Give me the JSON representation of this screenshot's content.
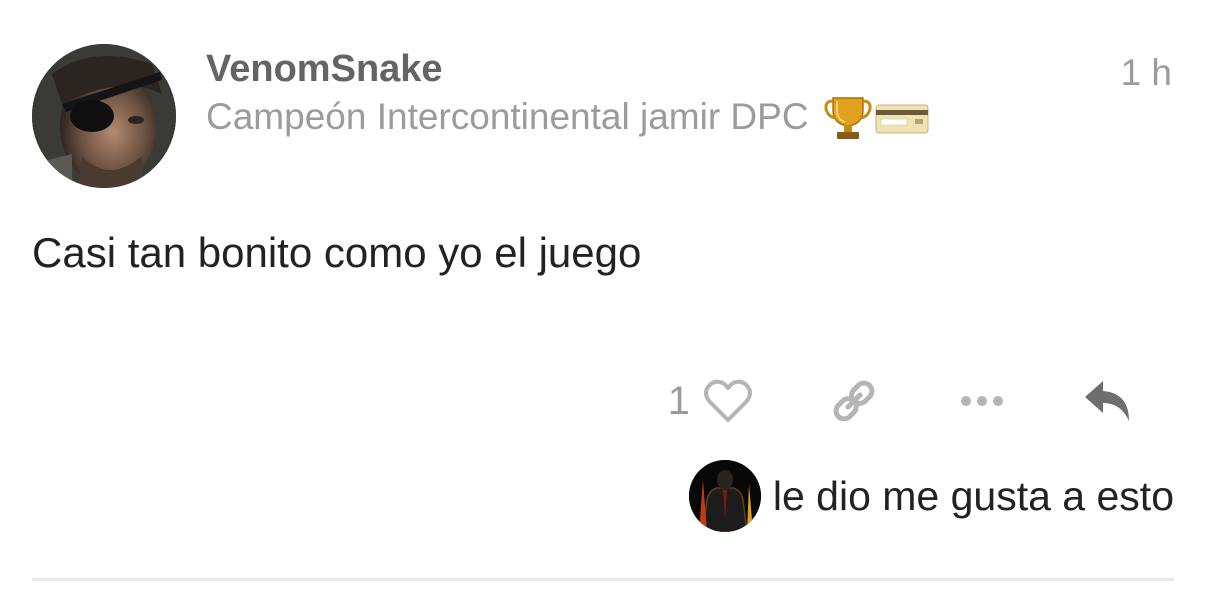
{
  "post": {
    "author": {
      "username": "VenomSnake",
      "title": "Campeón Intercontinental jamir DPC",
      "avatar": "avatar-eyepatch-man",
      "badges": [
        "trophy-icon",
        "credit-card-icon"
      ]
    },
    "time": "1 h",
    "body": "Casi tan bonito como yo el juego",
    "likes": {
      "count": "1",
      "liked_by_text": "le dio me gusta a esto",
      "liker_avatar": "dark-figure-avatar"
    },
    "actions": [
      "heart-icon",
      "link-icon",
      "more-icon",
      "reply-icon"
    ]
  },
  "colors": {
    "username": "#646464",
    "meta": "#9b9b9b",
    "text": "#222222",
    "icon_light": "#b5b5b5",
    "icon_dark": "#6e6e6e",
    "divider": "#e9e9e9"
  }
}
